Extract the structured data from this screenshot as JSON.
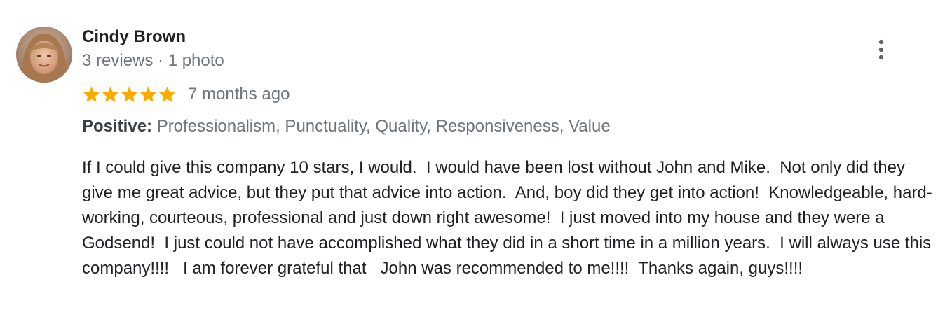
{
  "reviewer": {
    "name": "Cindy Brown",
    "meta": "3 reviews · 1 photo"
  },
  "rating": {
    "stars": 5,
    "max_stars": 5,
    "star_color": "#f9ab00",
    "age": "7 months ago"
  },
  "attributes": {
    "label": "Positive:",
    "value": " Professionalism, Punctuality, Quality, Responsiveness, Value"
  },
  "review": {
    "text": "If I could give this company 10 stars, I would.  I would have been lost without John and Mike.  Not only did they give me great advice, but they put that advice into action.  And, boy did they get into action!  Knowledgeable, hard-working, courteous, professional and just down right awesome!  I just moved into my house and they were a Godsend!  I just could not have accomplished what they did in a short time in a million years.  I will always use this company!!!!   I am forever grateful that   John was recommended to me!!!!  Thanks again, guys!!!!"
  },
  "icons": {
    "avatar": "avatar-photo",
    "more": "more-vert-icon",
    "star": "star-icon"
  },
  "colors": {
    "name": "#202124",
    "meta": "#70757a",
    "star": "#f9ab00",
    "text": "#202124"
  }
}
